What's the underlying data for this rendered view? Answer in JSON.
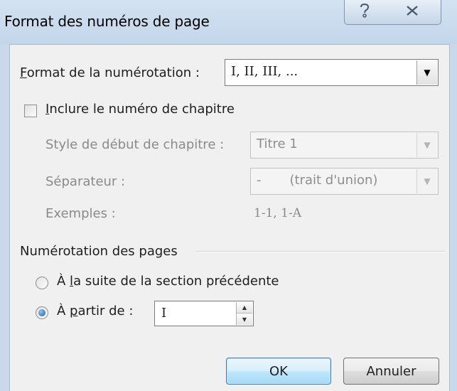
{
  "window": {
    "title": "Format des numéros de page",
    "help_icon": "help-icon",
    "close_icon": "close-icon"
  },
  "numbering_format": {
    "label_prefix": "",
    "label_accel": "F",
    "label_rest": "ormat de la numérotation :",
    "value": "I, II, III, ..."
  },
  "include_chapter": {
    "label_accel": "I",
    "label_rest": "nclure le numéro de chapitre",
    "checked": false
  },
  "chapter_style": {
    "label": "Style de début de chapitre :",
    "value": "Titre 1"
  },
  "separator": {
    "label": "Séparateur :",
    "value_symbol": "-",
    "value_text": "(trait d'union)"
  },
  "examples": {
    "label": "Exemples :",
    "value": "1-1, 1-A"
  },
  "page_numbering": {
    "group_label": "Numérotation des pages",
    "continue": {
      "label_pre": "À ",
      "label_accel": "l",
      "label_rest": "a suite de la section précédente",
      "selected": false
    },
    "start_at": {
      "label_pre": "À ",
      "label_accel": "p",
      "label_rest": "artir de :",
      "selected": true,
      "value": "I"
    }
  },
  "buttons": {
    "ok": "OK",
    "cancel": "Annuler"
  },
  "colors": {
    "titlebar": "#c9d9ea",
    "dialog_bg": "#f0f0f0",
    "default_button": "#bee6fd",
    "disabled_text": "#8a8a8a"
  }
}
